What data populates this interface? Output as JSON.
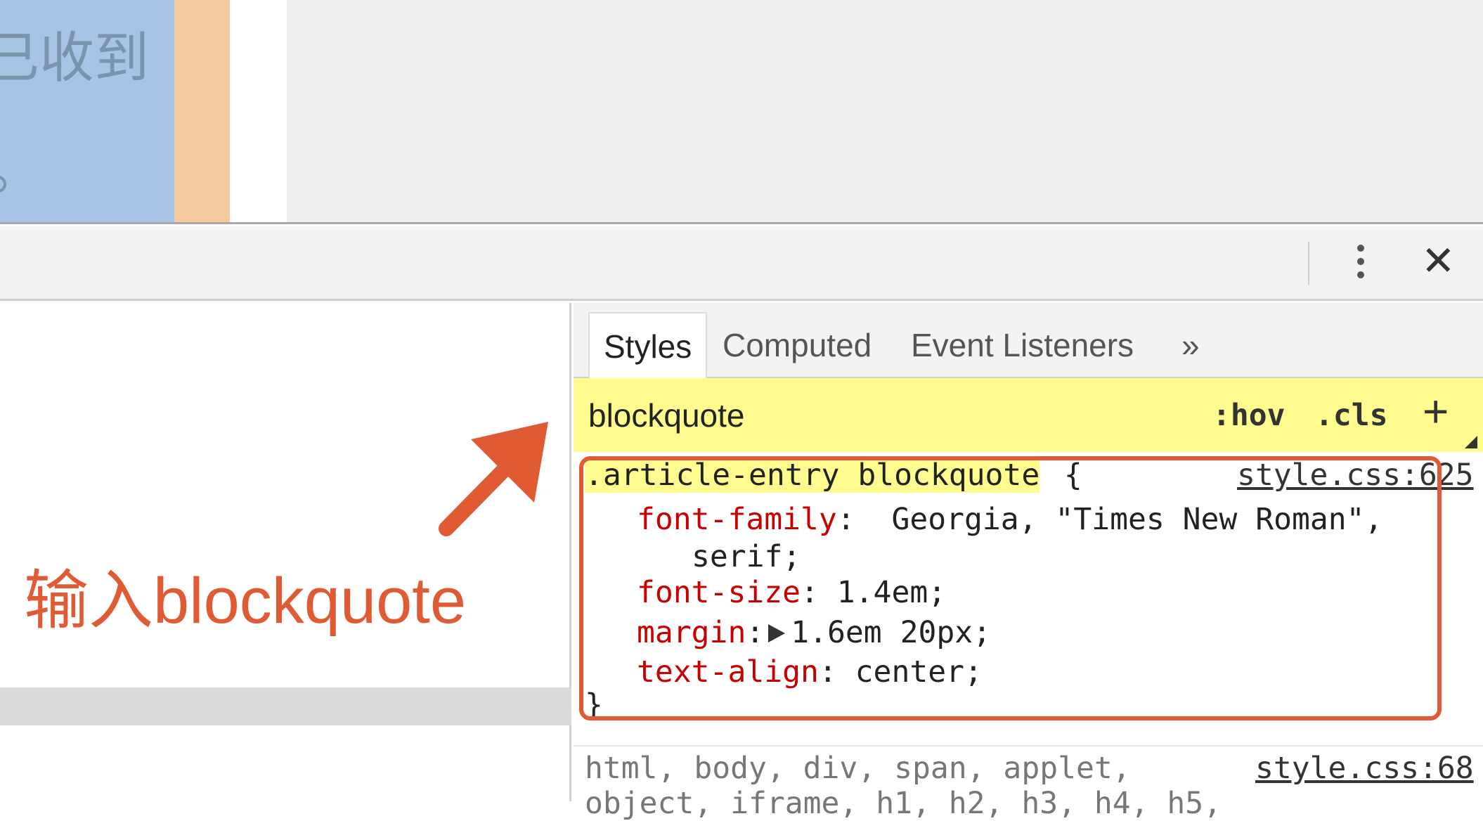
{
  "page": {
    "cjk_text": "已收到",
    "cjk_punct": "。"
  },
  "toolbar": {
    "more_icon": "vertical-dots",
    "close_icon": "x"
  },
  "annotation": {
    "text": "输入blockquote",
    "color": "#e05a33"
  },
  "tabs": [
    {
      "label": "Styles",
      "active": true
    },
    {
      "label": "Computed"
    },
    {
      "label": "Event Listeners"
    },
    {
      "label": "»"
    }
  ],
  "filter": {
    "value": "blockquote",
    "hov": ":hov",
    "cls": ".cls",
    "add": "+"
  },
  "rule": {
    "selector": ".article-entry blockquote",
    "open": " {",
    "source": "style.css:625",
    "declarations": [
      {
        "prop": "font-family",
        "value": " Georgia, \"Times New Roman\",",
        "cont": "serif;"
      },
      {
        "prop": "font-size",
        "value": " 1.4em;"
      },
      {
        "prop": "margin",
        "value": "1.6em 20px;"
      },
      {
        "prop": "text-align",
        "value": " center;"
      }
    ],
    "close": "}"
  },
  "rule2": {
    "selector": "html, body, div, span, applet,",
    "next": "object, iframe, h1, h2, h3, h4, h5,",
    "source": "style.css:68"
  }
}
